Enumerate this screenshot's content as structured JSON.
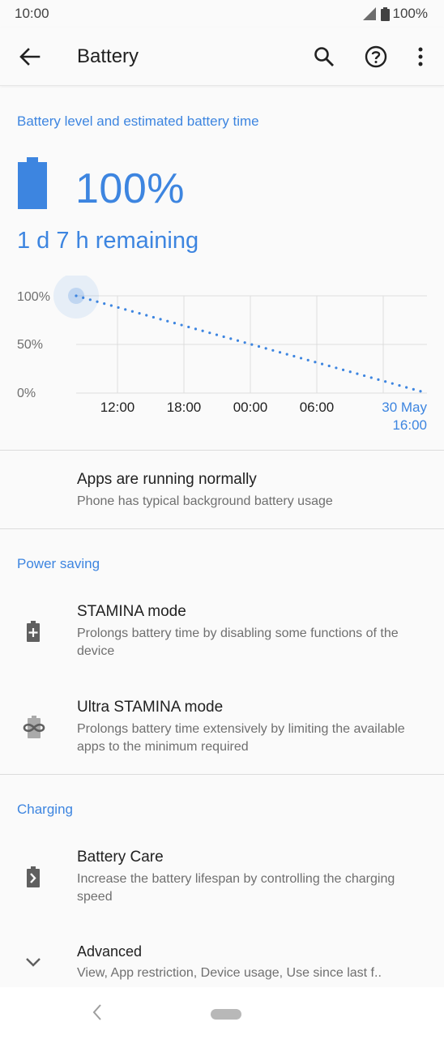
{
  "status_bar": {
    "time": "10:00",
    "battery_text": "100%"
  },
  "app_bar": {
    "title": "Battery",
    "icons": [
      "back-arrow-icon",
      "search-icon",
      "help-icon",
      "more-vert-icon"
    ]
  },
  "battery_section": {
    "header": "Battery level and estimated battery time",
    "percent": "100%",
    "remaining": "1 d 7 h remaining"
  },
  "chart_data": {
    "type": "line",
    "y_ticks": [
      "100%",
      "50%",
      "0%"
    ],
    "x_ticks": [
      "12:00",
      "18:00",
      "00:00",
      "06:00"
    ],
    "end_label_line1": "30 May",
    "end_label_line2": "16:00",
    "ylim": [
      0,
      100
    ],
    "series": [
      {
        "values": [
          100,
          0
        ],
        "style": "dotted",
        "color": "#3d85e0"
      }
    ]
  },
  "status_row": {
    "title": "Apps are running normally",
    "subtitle": "Phone has typical background battery usage"
  },
  "power_saving": {
    "header": "Power saving",
    "stamina": {
      "title": "STAMINA mode",
      "subtitle": "Prolongs battery time by disabling some functions of the device"
    },
    "ultra": {
      "title": "Ultra STAMINA mode",
      "subtitle": "Prolongs battery time extensively by limiting the available apps to the minimum required"
    }
  },
  "charging": {
    "header": "Charging",
    "care": {
      "title": "Battery Care",
      "subtitle": "Increase the battery lifespan by controlling the charging speed"
    },
    "advanced": {
      "title": "Advanced",
      "subtitle": "View, App restriction, Device usage, Use since last f.."
    }
  },
  "colors": {
    "accent": "#3d85e0",
    "text": "#212121",
    "secondary": "#6f6f6f",
    "icon": "#5f5f5f"
  }
}
